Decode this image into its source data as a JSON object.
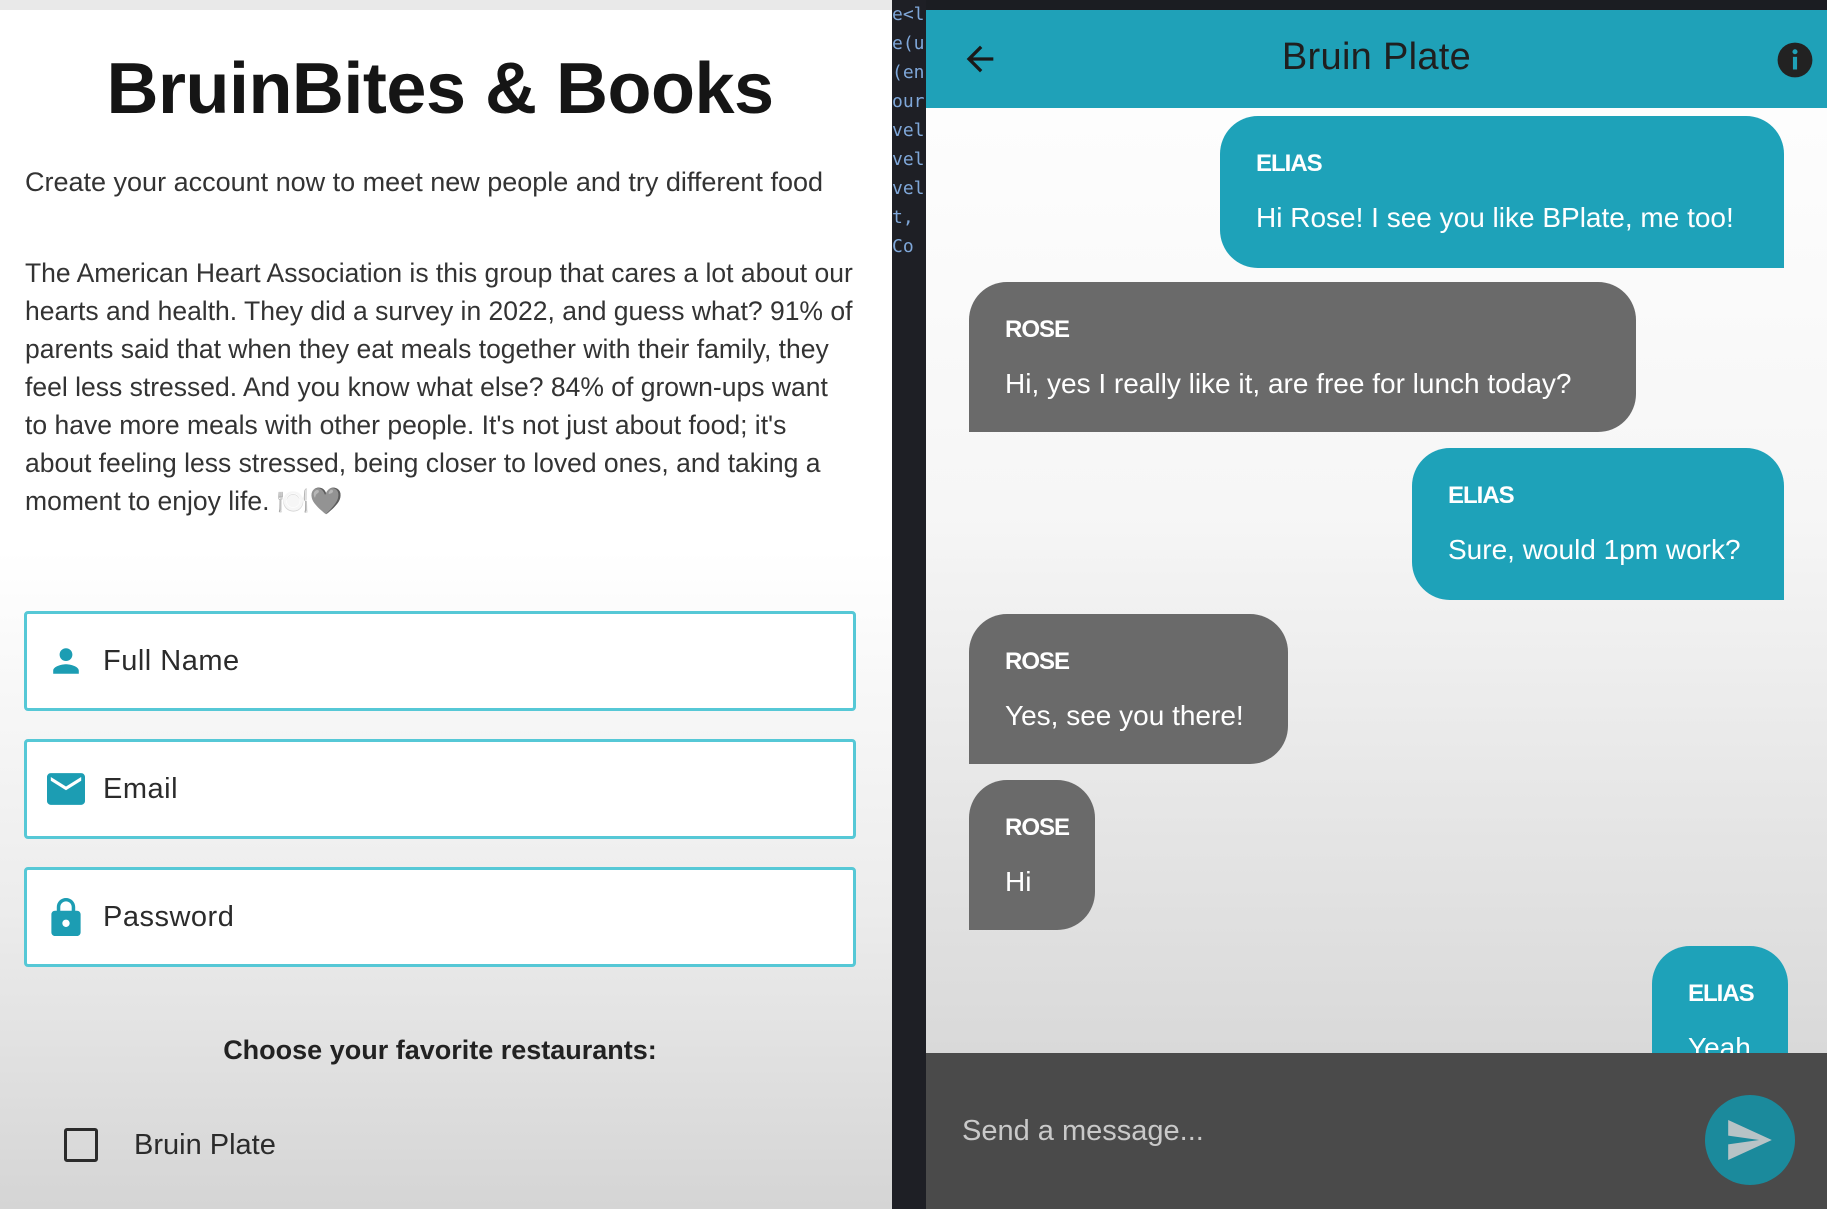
{
  "signup": {
    "title": "BruinBites & Books",
    "subtitle": "Create your account now to meet new people and try different food",
    "blurb": "The American Heart Association is this group that cares a lot about our hearts and health. They did a survey in 2022, and guess what? 91% of parents said that when they eat meals together with their family, they feel less stressed. And you know what else? 84% of grown-ups want to have more meals with other people. It's not just about food; it's about feeling less stressed, being closer to loved ones, and taking a moment to enjoy life. 🍽️🩶",
    "fields": {
      "full_name_placeholder": "Full Name",
      "email_placeholder": "Email",
      "password_placeholder": "Password"
    },
    "restaurants_label": "Choose your favorite restaurants:",
    "restaurants": [
      {
        "label": "Bruin Plate",
        "checked": false
      }
    ]
  },
  "code_strip": [
    "e<l",
    "",
    "",
    "e(u",
    "(en",
    "our",
    "vel",
    "vel",
    "vel",
    "t,",
    "",
    "Co"
  ],
  "chat": {
    "title": "Bruin Plate",
    "messages": [
      {
        "sender": "ELIAS",
        "text": "Hi Rose! I see you like BPlate, me too!"
      },
      {
        "sender": "ROSE",
        "text": "Hi, yes I really like it, are free for lunch today?"
      },
      {
        "sender": "ELIAS",
        "text": "Sure, would 1pm work?"
      },
      {
        "sender": "ROSE",
        "text": "Yes, see you there!"
      },
      {
        "sender": "ROSE",
        "text": "Hi"
      },
      {
        "sender": "ELIAS",
        "text": "Yeah"
      }
    ],
    "composer_placeholder": "Send a message..."
  },
  "colors": {
    "accent": "#1fa1b8",
    "field_border": "#56c8d6",
    "their_bubble": "#6a6a6a",
    "composer_bg": "#4a4a4a"
  },
  "icons": {
    "back": "arrow-back-icon",
    "info": "info-icon",
    "person": "person-icon",
    "email": "mail-icon",
    "password": "lock-icon",
    "send": "send-icon"
  }
}
